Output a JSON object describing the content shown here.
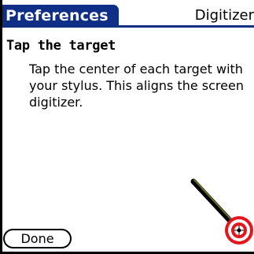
{
  "header": {
    "title": "Preferences",
    "panel": "Digitizer"
  },
  "content": {
    "heading": "Tap the target",
    "instructions": "Tap the center of each target with your stylus.  This aligns the screen digitizer."
  },
  "buttons": {
    "done_label": "Done"
  },
  "colors": {
    "title_bar": "#0f2f86",
    "target_red": "#e2161c"
  },
  "icons": {
    "target": "target-icon",
    "stylus": "stylus-icon"
  }
}
